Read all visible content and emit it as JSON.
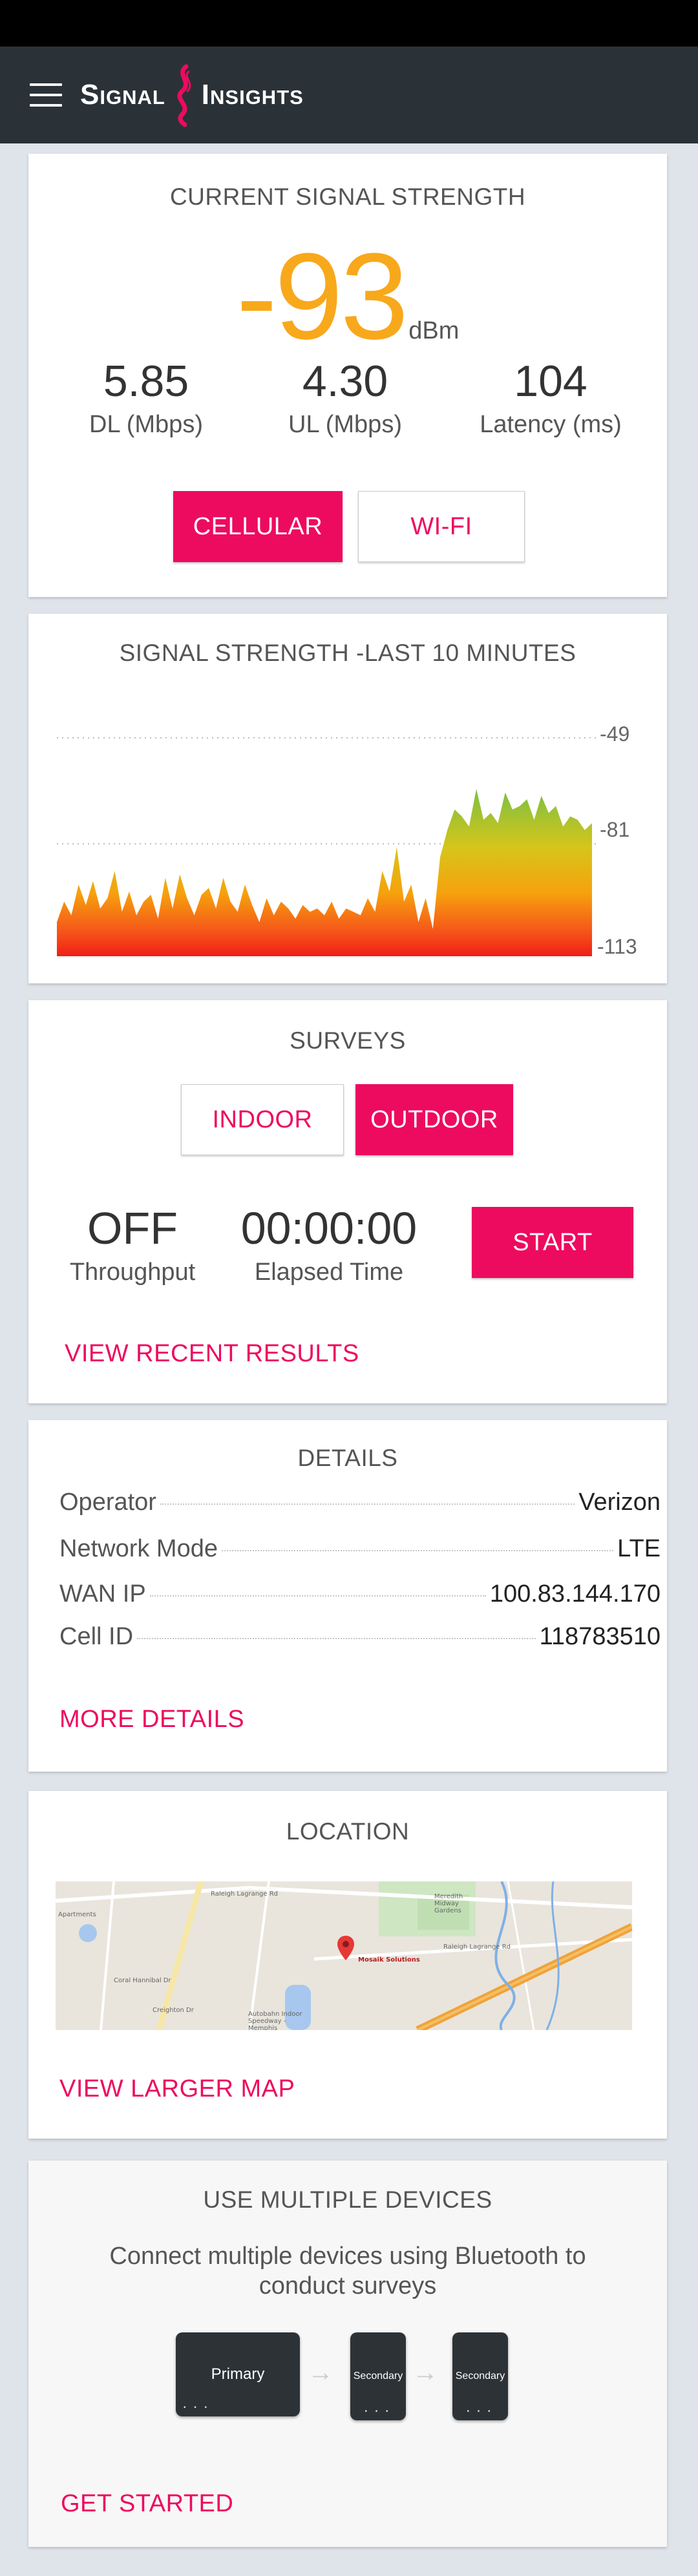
{
  "app": {
    "brand_left": "Signal",
    "brand_right": "Insights"
  },
  "signal": {
    "title": "CURRENT SIGNAL STRENGTH",
    "value": "-93",
    "unit": "dBm",
    "metrics": [
      {
        "value": "5.85",
        "label": "DL (Mbps)"
      },
      {
        "value": "4.30",
        "label": "UL (Mbps)"
      },
      {
        "value": "104",
        "label": "Latency (ms)"
      }
    ],
    "buttons": {
      "cellular": "CELLULAR",
      "wifi": "WI-FI"
    },
    "selected": "CELLULAR"
  },
  "history": {
    "title": "SIGNAL STRENGTH -LAST 10 MINUTES",
    "chart_data": {
      "type": "area",
      "title": "SIGNAL STRENGTH -LAST 10 MINUTES",
      "y_ticks": [
        "-49",
        "-81",
        "-113"
      ],
      "ylim": [
        -113,
        -49
      ],
      "unit": "dBm",
      "values": [
        -103,
        -97,
        -101,
        -92,
        -98,
        -91,
        -99,
        -96,
        -88,
        -100,
        -94,
        -101,
        -97,
        -95,
        -102,
        -90,
        -99,
        -89,
        -96,
        -101,
        -95,
        -93,
        -99,
        -90,
        -97,
        -100,
        -92,
        -98,
        -103,
        -96,
        -101,
        -97,
        -99,
        -102,
        -98,
        -100,
        -99,
        -101,
        -97,
        -102,
        -99,
        -100,
        -101,
        -96,
        -100,
        -88,
        -94,
        -81,
        -97,
        -92,
        -103,
        -96,
        -105,
        -84,
        -76,
        -70,
        -72,
        -75,
        -64,
        -73,
        -71,
        -74,
        -65,
        -70,
        -69,
        -67,
        -73,
        -66,
        -71,
        -69,
        -75,
        -72,
        -73,
        -76,
        -74
      ]
    }
  },
  "surveys": {
    "title": "SURVEYS",
    "buttons": {
      "indoor": "INDOOR",
      "outdoor": "OUTDOOR"
    },
    "selected": "OUTDOOR",
    "throughput": {
      "value": "OFF",
      "label": "Throughput"
    },
    "elapsed": {
      "value": "00:00:00",
      "label": "Elapsed Time"
    },
    "start": "START",
    "recent": "VIEW RECENT RESULTS"
  },
  "details": {
    "title": "DETAILS",
    "rows": [
      {
        "key": "Operator",
        "value": "Verizon"
      },
      {
        "key": "Network Mode",
        "value": "LTE"
      },
      {
        "key": "WAN IP",
        "value": "100.83.144.170"
      },
      {
        "key": "Cell ID",
        "value": "118783510"
      }
    ],
    "more": "MORE DETAILS"
  },
  "location": {
    "title": "LOCATION",
    "map_labels": {
      "place": "Mosaik Solutions",
      "park": "Meredith Midway Gardens",
      "road1": "Raleigh Lagrange Rd",
      "road2": "Raleigh Lagrange Rd",
      "school": "Autobahn Indoor Speedway - Memphis",
      "street1": "Coral Hannibal Dr",
      "street2": "Creighton Dr",
      "apts": "Apartments"
    },
    "larger": "VIEW LARGER MAP"
  },
  "devices": {
    "title": "USE MULTIPLE DEVICES",
    "description_line1": "Connect multiple devices using Bluetooth to",
    "description_line2": "conduct surveys",
    "primary": "Primary",
    "secondary1": "Secondary",
    "secondary2": "Secondary",
    "cta": "GET STARTED"
  },
  "colors": {
    "accent": "#ed0b5f",
    "signal_value": "#f8a81b",
    "app_bar": "#2a3238"
  }
}
